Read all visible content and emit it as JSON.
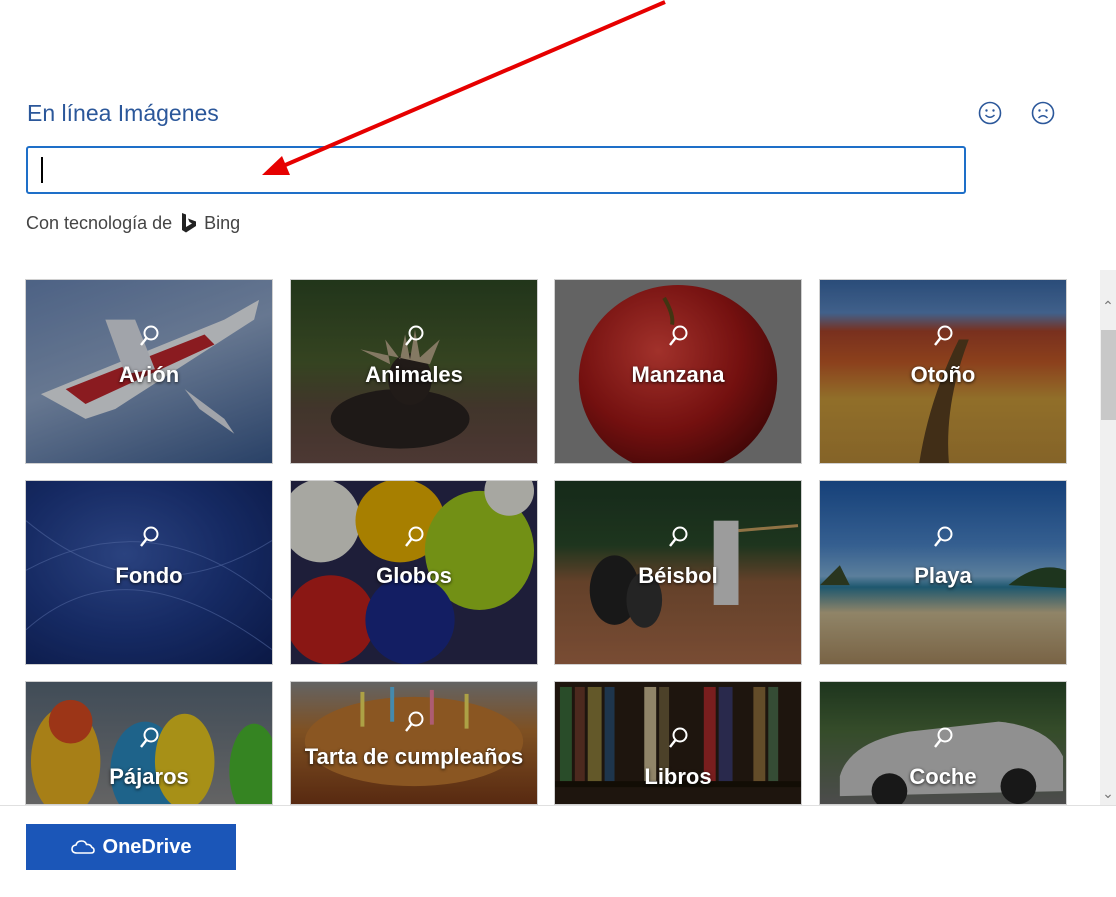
{
  "header": {
    "title": "En línea Imágenes"
  },
  "search": {
    "value": "",
    "placeholder": ""
  },
  "powered_by": {
    "text": "Con tecnología de",
    "brand": "Bing"
  },
  "tiles": [
    {
      "label": "Avión"
    },
    {
      "label": "Animales"
    },
    {
      "label": "Manzana"
    },
    {
      "label": "Otoño"
    },
    {
      "label": "Fondo"
    },
    {
      "label": "Globos"
    },
    {
      "label": "Béisbol"
    },
    {
      "label": "Playa"
    },
    {
      "label": "Pájaros"
    },
    {
      "label": "Tarta de cumpleaños"
    },
    {
      "label": "Libros"
    },
    {
      "label": "Coche"
    }
  ],
  "footer": {
    "onedrive_label": "OneDrive"
  },
  "colors": {
    "accent": "#2b579a",
    "button": "#1b56b8",
    "annotation_arrow": "#e60000"
  },
  "icons": {
    "smile": "smile-icon",
    "frown": "frown-icon",
    "search": "search-icon",
    "bing": "bing-logo-icon",
    "cloud": "cloud-icon"
  }
}
